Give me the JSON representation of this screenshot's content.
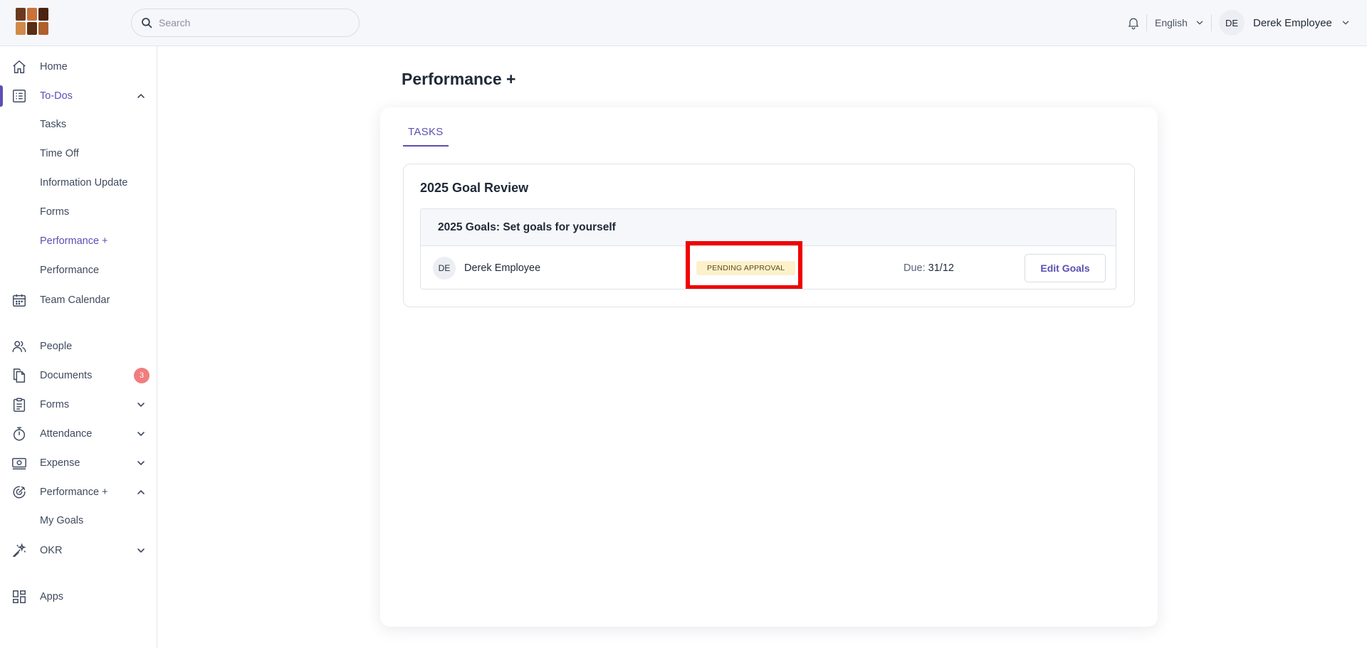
{
  "header": {
    "search_placeholder": "Search",
    "language": "English",
    "user_initials": "DE",
    "user_name": "Derek Employee"
  },
  "sidebar": {
    "items": [
      {
        "label": "Home",
        "icon": "home-icon"
      },
      {
        "label": "To-Dos",
        "icon": "checklist-icon",
        "expanded": true,
        "active": true
      },
      {
        "label": "Tasks",
        "sub": true
      },
      {
        "label": "Time Off",
        "sub": true
      },
      {
        "label": "Information Update",
        "sub": true
      },
      {
        "label": "Forms",
        "sub": true
      },
      {
        "label": "Performance +",
        "sub": true,
        "active": true
      },
      {
        "label": "Performance",
        "sub": true
      },
      {
        "label": "Team Calendar",
        "icon": "calendar-icon"
      },
      {
        "label": "People",
        "icon": "people-icon"
      },
      {
        "label": "Documents",
        "icon": "documents-icon",
        "badge": "3"
      },
      {
        "label": "Forms",
        "icon": "clipboard-icon",
        "expanded": false
      },
      {
        "label": "Attendance",
        "icon": "stopwatch-icon",
        "expanded": false
      },
      {
        "label": "Expense",
        "icon": "money-icon",
        "expanded": false
      },
      {
        "label": "Performance +",
        "icon": "target-icon",
        "expanded": true
      },
      {
        "label": "My Goals",
        "sub": true
      },
      {
        "label": "OKR",
        "icon": "magic-wand-icon",
        "expanded": false
      },
      {
        "label": "Apps",
        "icon": "apps-grid-icon"
      }
    ]
  },
  "main": {
    "title": "Performance +",
    "tab": "TASKS",
    "panel_title": "2025 Goal Review",
    "group_title": "2025 Goals: Set goals for yourself",
    "row": {
      "initials": "DE",
      "employee": "Derek Employee",
      "status": "PENDING APPROVAL",
      "due_label": "Due:",
      "due_value": "31/12",
      "action": "Edit Goals"
    }
  },
  "colors": {
    "accent": "#5b4fb3",
    "status_bg": "#fdf1cc",
    "badge": "#f07d7d",
    "highlight": "#f00000"
  }
}
